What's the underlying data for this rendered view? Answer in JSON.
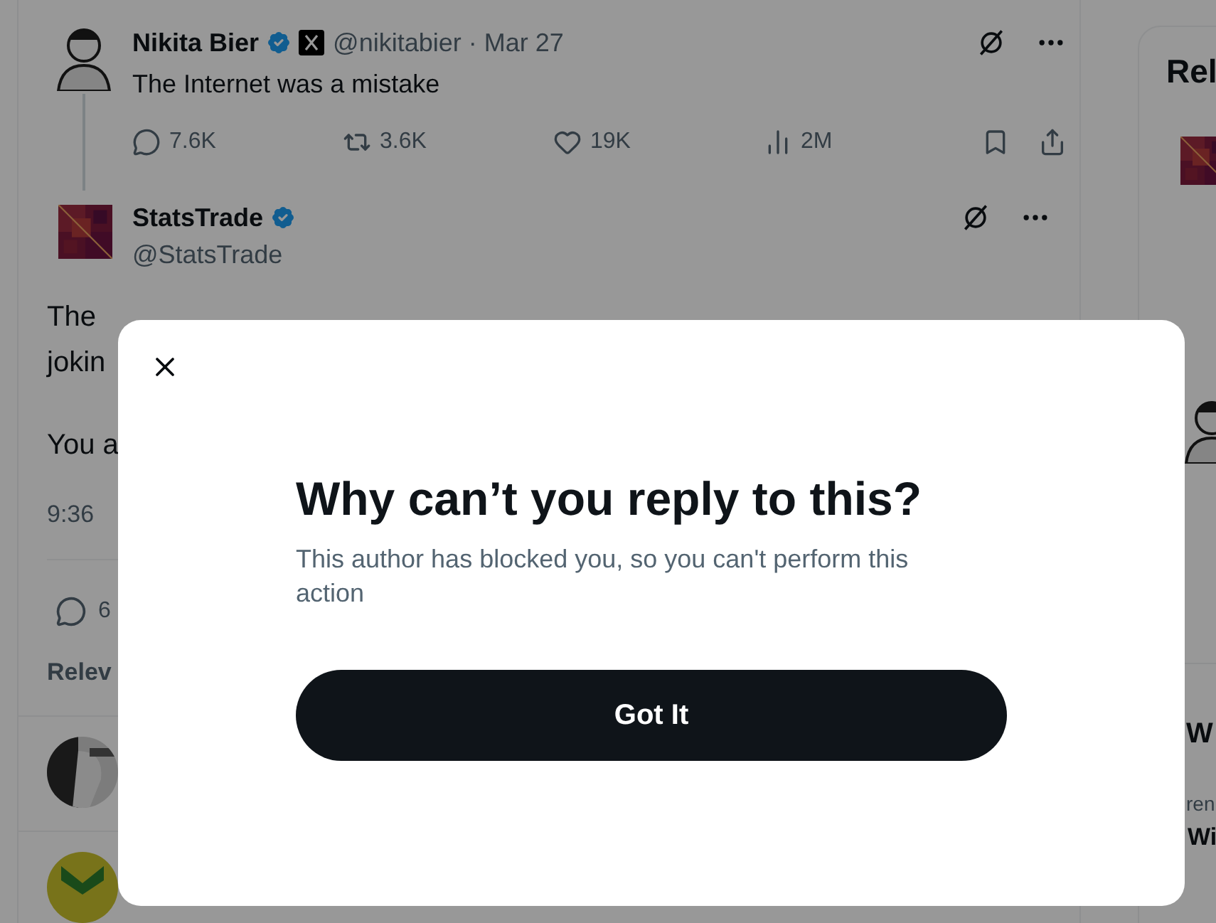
{
  "thread": [
    {
      "kind": "parent",
      "name": "Nikita Bier",
      "verified": true,
      "affiliate_badge": true,
      "handle_date": "@nikitabier · Mar 27",
      "text": "The Internet was a mistake",
      "actions": [
        {
          "kind": "reply",
          "count": "7.6K"
        },
        {
          "kind": "repost",
          "count": "3.6K"
        },
        {
          "kind": "like",
          "count": "19K"
        },
        {
          "kind": "views",
          "count": "2M"
        }
      ]
    },
    {
      "kind": "main",
      "name": "StatsTrade",
      "verified": true,
      "handle": "@StatsTrade",
      "lines": [
        "The",
        "jokin",
        "You a"
      ],
      "time": "9:36",
      "reply_count": "6",
      "sort_label": "Relev"
    }
  ],
  "sidebar": {
    "title": "Rel",
    "section_title": "W",
    "trend_meta": "ren",
    "trend_name": "Wi"
  },
  "dialog": {
    "title": "Why can’t you reply to this?",
    "message": "This author has blocked you, so you can't perform this action",
    "button": "Got It"
  }
}
